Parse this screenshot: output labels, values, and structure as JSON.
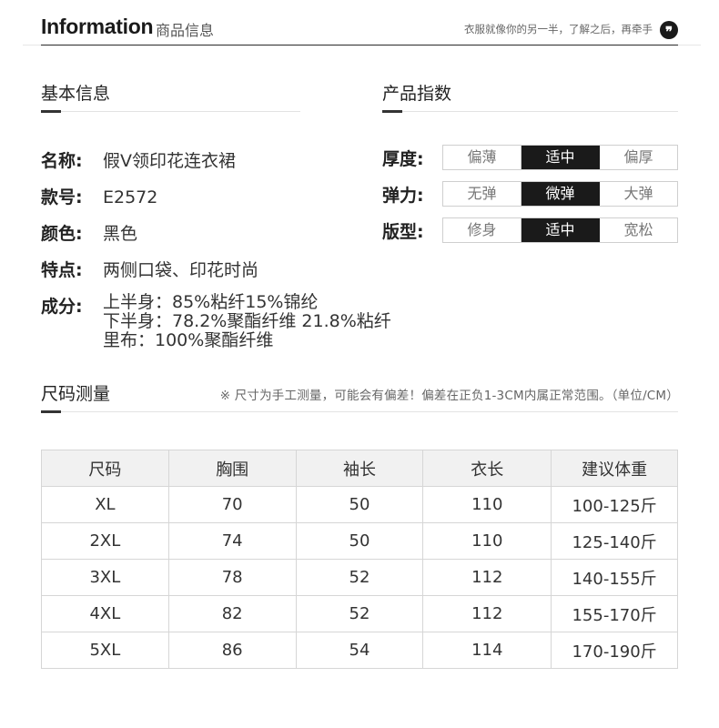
{
  "header": {
    "brand": "Information",
    "brand_sub": "商品信息",
    "slogan": "衣服就像你的另一半，了解之后，再牵手",
    "quote_glyph": "❞"
  },
  "basic": {
    "title": "基本信息",
    "name": {
      "label": "名称:",
      "value": "假V领印花连衣裙"
    },
    "code": {
      "label": "款号:",
      "value": "E2572"
    },
    "color": {
      "label": "颜色:",
      "value": "黑色"
    },
    "feature": {
      "label": "特点:",
      "value": "两侧口袋、印花时尚"
    },
    "composition": {
      "label": "成分:",
      "lines": [
        "上半身：85%粘纤15%锦纶",
        "下半身：78.2%聚酯纤维 21.8%粘纤",
        "里布：100%聚酯纤维"
      ]
    }
  },
  "indices": {
    "title": "产品指数",
    "rows": [
      {
        "label": "厚度:",
        "options": [
          "偏薄",
          "适中",
          "偏厚"
        ],
        "selected": 1
      },
      {
        "label": "弹力:",
        "options": [
          "无弹",
          "微弹",
          "大弹"
        ],
        "selected": 1
      },
      {
        "label": "版型:",
        "options": [
          "修身",
          "适中",
          "宽松"
        ],
        "selected": 1
      }
    ]
  },
  "size": {
    "title": "尺码测量",
    "note": "※ 尺寸为手工测量，可能会有偏差！偏差在正负1-3CM内属正常范围。（单位/CM）",
    "columns": [
      "尺码",
      "胸围",
      "袖长",
      "衣长",
      "建议体重"
    ],
    "rows": [
      [
        "XL",
        "70",
        "50",
        "110",
        "100-125斤"
      ],
      [
        "2XL",
        "74",
        "50",
        "110",
        "125-140斤"
      ],
      [
        "3XL",
        "78",
        "52",
        "112",
        "140-155斤"
      ],
      [
        "4XL",
        "82",
        "52",
        "112",
        "155-170斤"
      ],
      [
        "5XL",
        "86",
        "54",
        "114",
        "170-190斤"
      ]
    ]
  }
}
